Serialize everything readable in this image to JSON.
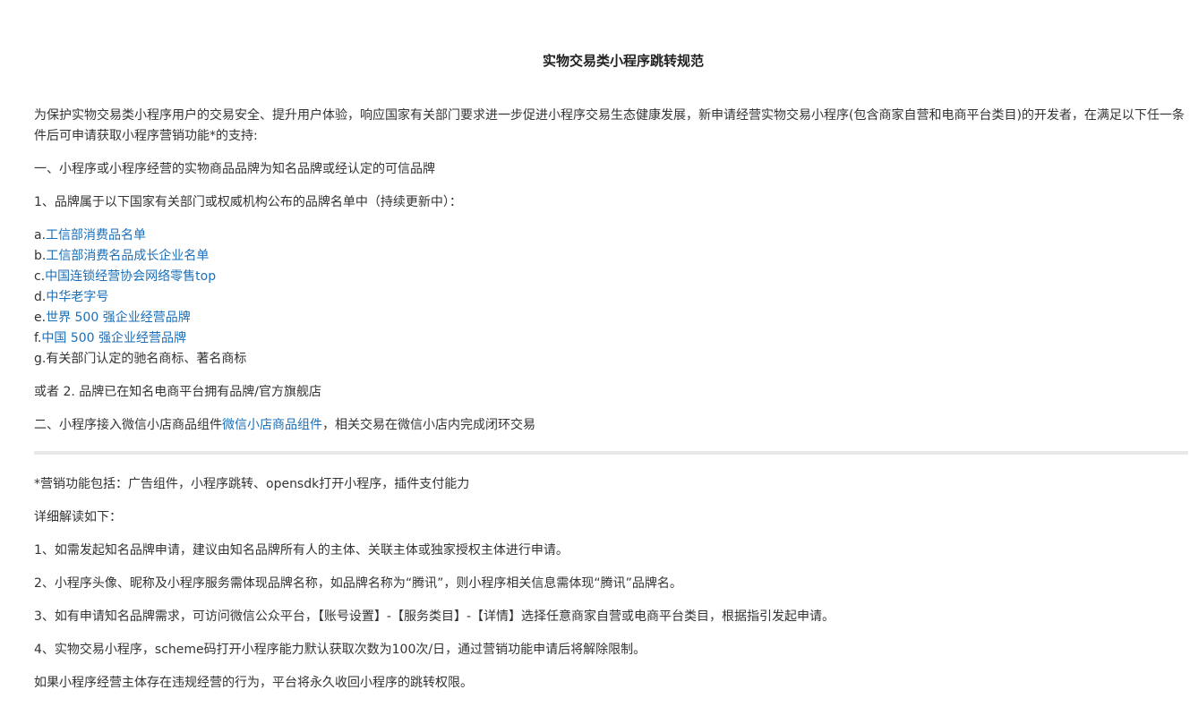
{
  "title": "实物交易类小程序跳转规范",
  "intro": "为保护实物交易类小程序用户的交易安全、提升用户体验，响应国家有关部门要求进一步促进小程序交易生态健康发展，新申请经营实物交易小程序(包含商家自营和电商平台类目)的开发者，在满足以下任一条件后可申请获取小程序营销功能*的支持:",
  "section1": {
    "heading": "一、小程序或小程序经营的实物商品品牌为知名品牌或经认定的可信品牌",
    "sub1": "1、品牌属于以下国家有关部门或权威机构公布的品牌名单中（持续更新中）：",
    "list": [
      {
        "prefix": "a.",
        "text": "工信部消费品名单",
        "link": true
      },
      {
        "prefix": "b.",
        "text": "工信部消费名品成长企业名单",
        "link": true
      },
      {
        "prefix": "c.",
        "text": "中国连锁经营协会网络零售top",
        "link": true
      },
      {
        "prefix": "d.",
        "text": "中华老字号",
        "link": true
      },
      {
        "prefix": "e.",
        "text": "世界 500 强企业经营品牌",
        "link": true
      },
      {
        "prefix": "f.",
        "text": "中国 500 强企业经营品牌",
        "link": true
      },
      {
        "prefix": "g.",
        "text": "有关部门认定的驰名商标、著名商标",
        "link": false
      }
    ],
    "sub2": "或者 2. 品牌已在知名电商平台拥有品牌/官方旗舰店"
  },
  "section2": {
    "before": "二、小程序接入微信小店商品组件",
    "link": "微信小店商品组件",
    "after": "，相关交易在微信小店内完成闭环交易"
  },
  "notes": {
    "marketing": "*营销功能包括：广告组件，小程序跳转、opensdk打开小程序，插件支付能力",
    "detail_heading": "详细解读如下：",
    "items": [
      "1、如需发起知名品牌申请，建议由知名品牌所有人的主体、关联主体或独家授权主体进行申请。",
      "2、小程序头像、昵称及小程序服务需体现品牌名称，如品牌名称为“腾讯”，则小程序相关信息需体现“腾讯”品牌名。",
      "3、如有申请知名品牌需求，可访问微信公众平台，【账号设置】-【服务类目】-【详情】选择任意商家自营或电商平台类目，根据指引发起申请。",
      "4、实物交易小程序，scheme码打开小程序能力默认获取次数为100次/日，通过营销功能申请后将解除限制。"
    ],
    "final": "如果小程序经营主体存在违规经营的行为，平台将永久收回小程序的跳转权限。"
  },
  "colors": {
    "text": "#333333",
    "link": "#1b6fb8",
    "divider": "#e8e8e8"
  }
}
